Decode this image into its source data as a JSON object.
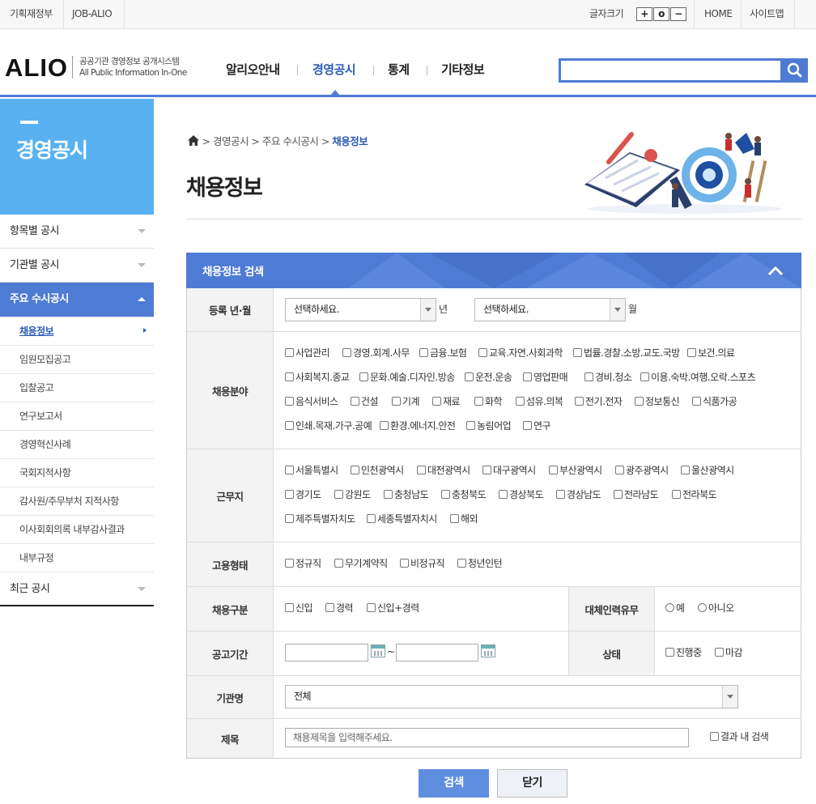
{
  "topbar": {
    "left_links": [
      "기획재정부",
      "JOB-ALIO"
    ],
    "font_size_label": "글자크기",
    "font_buttons": [
      "+",
      "o",
      "−"
    ],
    "right_links": [
      "HOME",
      "사이트맵"
    ]
  },
  "header": {
    "logo": "ALIO",
    "logo_sub1": "공공기관 경영정보 공개시스템",
    "logo_sub2": "All Public Information In-One",
    "nav": [
      "알리오안내",
      "경영공시",
      "통계",
      "기타정보"
    ],
    "active_nav": "경영공시",
    "accent": "#4e7bd4"
  },
  "sidebar": {
    "title": "경영공시",
    "menu": [
      {
        "label": "항목별 공시",
        "open": false
      },
      {
        "label": "기관별 공시",
        "open": false
      },
      {
        "label": "주요 수시공시",
        "open": true,
        "children": [
          "채용정보",
          "임원모집공고",
          "입찰공고",
          "연구보고서",
          "경영혁신사례",
          "국회지적사항",
          "감사원/주무부처 지적사항",
          "이사회회의록 내부감사결과",
          "내부규정"
        ]
      },
      {
        "label": "최근 공시",
        "open": false
      }
    ],
    "active_child": "채용정보"
  },
  "breadcrumb": {
    "items": [
      "경영공시",
      "주요 수시공시"
    ],
    "current": "채용정보"
  },
  "page_title": "채용정보",
  "search_panel": {
    "title": "채용정보 검색",
    "rows": {
      "reg_label": "등록 년·월",
      "year_value": "선택하세요.",
      "year_unit": "년",
      "month_value": "선택하세요.",
      "month_unit": "월",
      "field_label": "채용분야",
      "fields": [
        [
          "사업관리",
          "경영.회계.사무",
          "금융.보험",
          "교육.자연.사회과학",
          "법률.경찰.소방.교도.국방",
          "보건.의료"
        ],
        [
          "사회복지.종교",
          "문화.예술.디자인.방송",
          "운전.운송",
          "영업판매",
          "경비.청소",
          "이용.숙박.여행.오락.스포츠"
        ],
        [
          "음식서비스",
          "건설",
          "기계",
          "재료",
          "화학",
          "섬유.의복",
          "전기.전자",
          "정보통신",
          "식품가공"
        ],
        [
          "인쇄.목재.가구.공예",
          "환경.에너지.안전",
          "농림어업",
          "연구"
        ]
      ],
      "region_label": "근무지",
      "regions": [
        [
          "서울특별시",
          "인천광역시",
          "대전광역시",
          "대구광역시",
          "부산광역시",
          "광주광역시",
          "울산광역시"
        ],
        [
          "경기도",
          "강원도",
          "충청남도",
          "충청북도",
          "경상북도",
          "경상남도",
          "전라남도",
          "전라북도"
        ],
        [
          "제주특별자치도",
          "세종특별자치시",
          "해외"
        ]
      ],
      "emp_label": "고용형태",
      "emp_types": [
        "정규직",
        "무기계약직",
        "비정규직",
        "청년인턴"
      ],
      "hire_label": "채용구분",
      "hire_types": [
        "신입",
        "경력",
        "신입+경력"
      ],
      "sub_label": "대체인력유무",
      "sub_options": [
        "예",
        "아니오"
      ],
      "period_label": "공고기간",
      "period_sep": "~",
      "status_label": "상태",
      "status_options": [
        "진행중",
        "마감"
      ],
      "org_label": "기관명",
      "org_value": "전체",
      "title_label": "제목",
      "title_placeholder": "채용제목을 입력해주세요.",
      "in_result": "결과 내 검색"
    }
  },
  "buttons": {
    "search": "검색",
    "close": "닫기"
  }
}
